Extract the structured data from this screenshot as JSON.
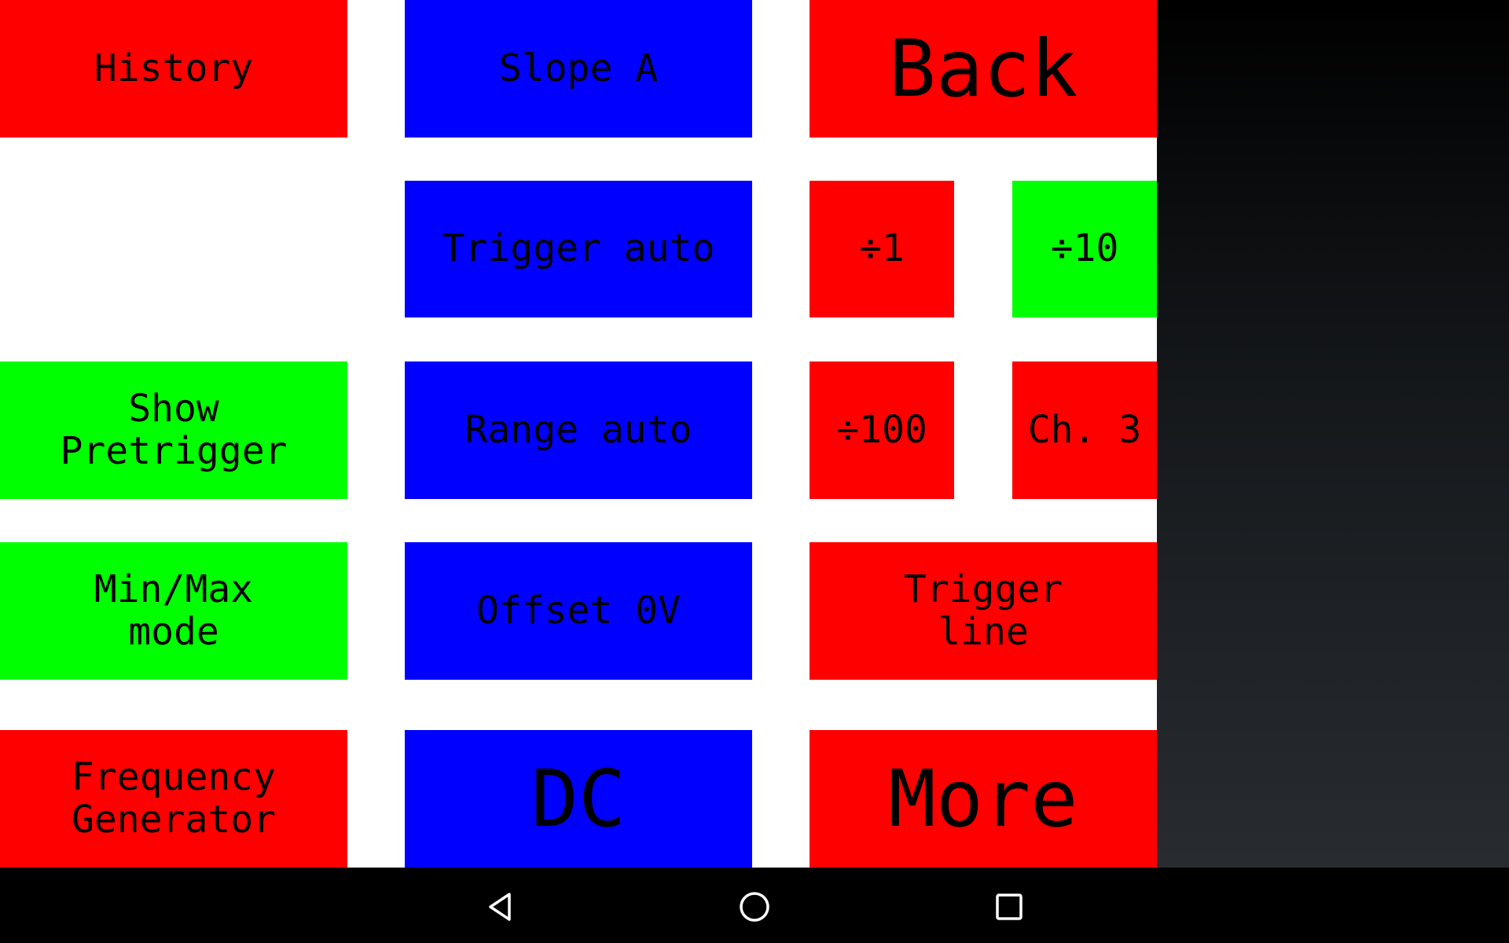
{
  "buttons": {
    "history": "History",
    "slope": "Slope A",
    "back": "Back",
    "trigger_auto": "Trigger auto",
    "div1": "÷1",
    "div10": "÷10",
    "show_pretrigger": "Show\nPretrigger",
    "range_auto": "Range auto",
    "div100": "÷100",
    "channel": "Ch. 3",
    "minmax": "Min/Max\nmode",
    "offset": "Offset 0V",
    "trigger_line": "Trigger\nline",
    "freq_gen": "Frequency\nGenerator",
    "coupling": "DC",
    "more": "More"
  },
  "colors": {
    "red": "#ff0000",
    "blue": "#0000ff",
    "green": "#00ff00",
    "nav_bar": "#000000"
  },
  "nav": {
    "back_icon": "triangle-back-icon",
    "home_icon": "circle-home-icon",
    "recents_icon": "square-recents-icon"
  }
}
